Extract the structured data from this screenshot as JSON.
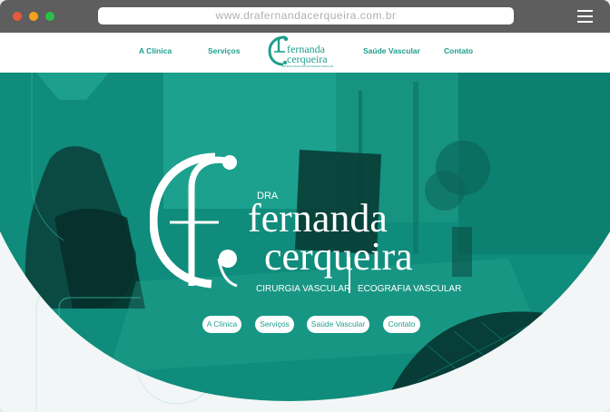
{
  "browser": {
    "url": "www.drafernandacerqueira.com.br"
  },
  "nav": {
    "items": [
      {
        "label": "A Clínica"
      },
      {
        "label": "Serviços"
      },
      {
        "label": "Saúde Vascular"
      },
      {
        "label": "Contato"
      }
    ]
  },
  "logo": {
    "prefix": "DRA",
    "first_name": "fernanda",
    "last_name": "cerqueira",
    "specialty_left": "CIRURGIA VASCULAR",
    "specialty_right": "ECOGRAFIA VASCULAR",
    "small_tagline": "CIRURGIA VASCULAR  ECOGRAFIA VASCULAR"
  },
  "hero": {
    "buttons": [
      {
        "label": "A Clínica"
      },
      {
        "label": "Serviços"
      },
      {
        "label": "Saúde Vascular"
      },
      {
        "label": "Contato"
      }
    ]
  },
  "colors": {
    "brand_teal": "#1e9e8c",
    "hero_overlay": "#0f8c7c",
    "chrome": "#5e5e5e"
  },
  "icons": {
    "menu": "hamburger-icon",
    "window_controls": [
      "close-dot-icon",
      "minimize-dot-icon",
      "maximize-dot-icon"
    ]
  }
}
